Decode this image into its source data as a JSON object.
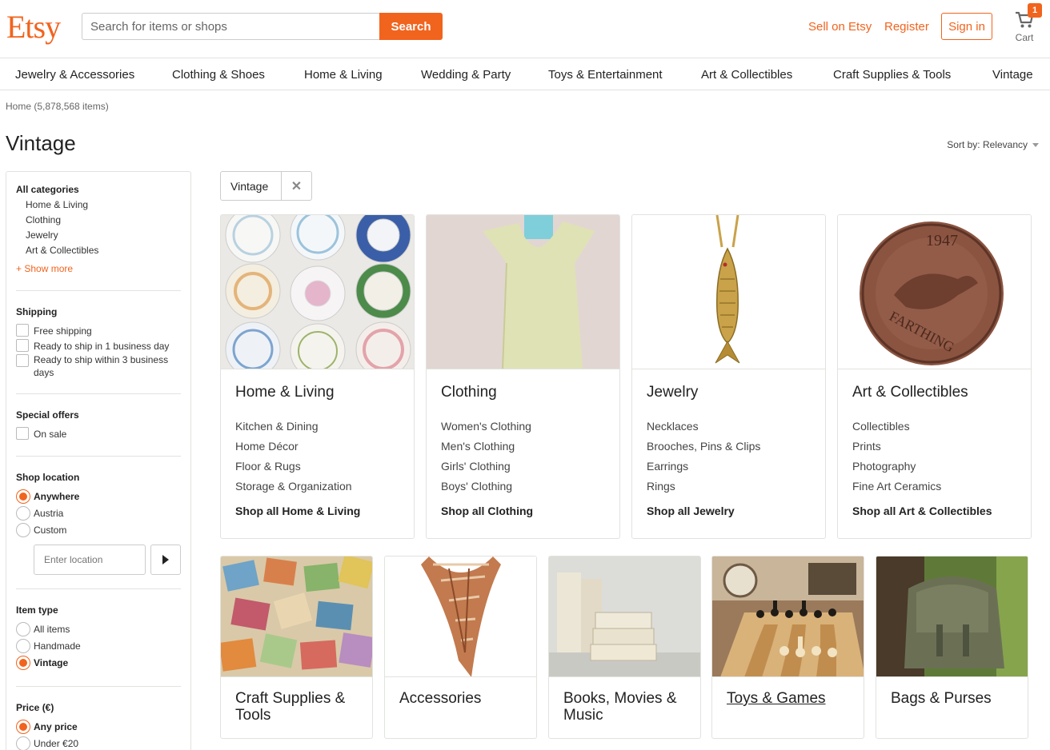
{
  "header": {
    "logo": "Etsy",
    "search_placeholder": "Search for items or shops",
    "search_button": "Search",
    "sell_link": "Sell on Etsy",
    "register_link": "Register",
    "signin_button": "Sign in",
    "cart_label": "Cart",
    "cart_count": "1"
  },
  "nav": {
    "items": [
      "Jewelry & Accessories",
      "Clothing & Shoes",
      "Home & Living",
      "Wedding & Party",
      "Toys & Entertainment",
      "Art & Collectibles",
      "Craft Supplies & Tools",
      "Vintage"
    ]
  },
  "breadcrumb": "Home (5,878,568 items)",
  "page_title": "Vintage",
  "sort_label": "Sort by: Relevancy",
  "sidebar": {
    "categories_heading": "All categories",
    "categories": [
      "Home & Living",
      "Clothing",
      "Jewelry",
      "Art & Collectibles"
    ],
    "show_more": "+ Show more",
    "shipping_heading": "Shipping",
    "shipping_options": [
      "Free shipping",
      "Ready to ship in 1 business day",
      "Ready to ship within 3 business days"
    ],
    "special_heading": "Special offers",
    "special_options": [
      "On sale"
    ],
    "location_heading": "Shop location",
    "location_options": [
      "Anywhere",
      "Austria",
      "Custom"
    ],
    "location_selected": "Anywhere",
    "location_placeholder": "Enter location",
    "itemtype_heading": "Item type",
    "itemtype_options": [
      "All items",
      "Handmade",
      "Vintage"
    ],
    "itemtype_selected": "Vintage",
    "price_heading": "Price (€)",
    "price_options": [
      "Any price",
      "Under €20"
    ],
    "price_selected": "Any price"
  },
  "filter_tag": "Vintage",
  "top_cards": [
    {
      "title": "Home & Living",
      "links": [
        "Kitchen & Dining",
        "Home Décor",
        "Floor & Rugs",
        "Storage & Organization"
      ],
      "shop_all": "Shop all Home & Living"
    },
    {
      "title": "Clothing",
      "links": [
        "Women's Clothing",
        "Men's Clothing",
        "Girls' Clothing",
        "Boys' Clothing"
      ],
      "shop_all": "Shop all Clothing"
    },
    {
      "title": "Jewelry",
      "links": [
        "Necklaces",
        "Brooches, Pins & Clips",
        "Earrings",
        "Rings"
      ],
      "shop_all": "Shop all Jewelry"
    },
    {
      "title": "Art & Collectibles",
      "links": [
        "Collectibles",
        "Prints",
        "Photography",
        "Fine Art Ceramics"
      ],
      "shop_all": "Shop all Art & Collectibles"
    }
  ],
  "bottom_cards": [
    {
      "title_line1": "Craft Supplies &",
      "title_line2": "Tools"
    },
    {
      "title_line1": "Accessories",
      "title_line2": ""
    },
    {
      "title_line1": "Books, Movies &",
      "title_line2": "Music"
    },
    {
      "title_line1": "Toys & Games",
      "title_line2": ""
    },
    {
      "title_line1": "Bags & Purses",
      "title_line2": ""
    }
  ],
  "coin_text": {
    "year": "1947",
    "word": "FARTHING"
  },
  "colors": {
    "accent": "#f1641e",
    "border": "#e1e3df"
  }
}
